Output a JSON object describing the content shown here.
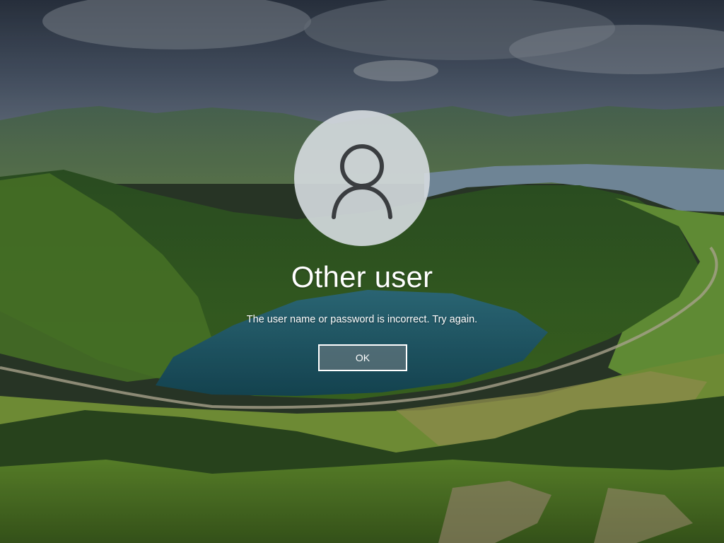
{
  "user": {
    "name": "Other user",
    "avatar_icon": "user-icon"
  },
  "error": {
    "message": "The user name or password is incorrect. Try again."
  },
  "dialog": {
    "ok_label": "OK"
  },
  "background": {
    "scene": "volcanic crater lake landscape",
    "sky_color": "#3e4a5a",
    "lake_color": "#1f5a6a",
    "grass_color": "#4f8a2a"
  }
}
